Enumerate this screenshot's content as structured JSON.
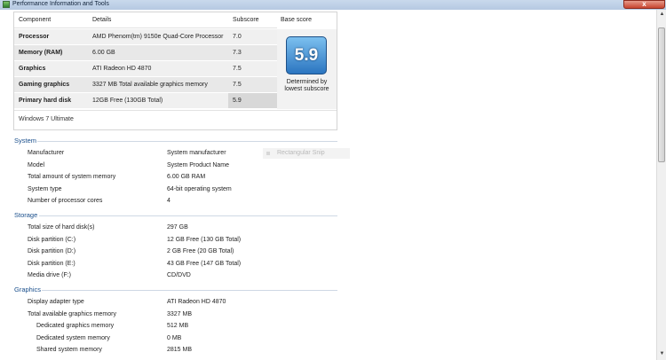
{
  "window": {
    "title": "Performance Information and Tools",
    "close_glyph": "x"
  },
  "score_table": {
    "headers": {
      "component": "Component",
      "details": "Details",
      "subscore": "Subscore",
      "base_score": "Base score"
    },
    "rows": [
      {
        "component": "Processor",
        "details": "AMD Phenom(tm) 9150e Quad-Core Processor",
        "subscore": "7.0"
      },
      {
        "component": "Memory (RAM)",
        "details": "6.00 GB",
        "subscore": "7.3"
      },
      {
        "component": "Graphics",
        "details": "ATI Radeon HD 4870",
        "subscore": "7.5"
      },
      {
        "component": "Gaming graphics",
        "details": "3327 MB Total available graphics memory",
        "subscore": "7.5"
      },
      {
        "component": "Primary hard disk",
        "details": "12GB Free (130GB Total)",
        "subscore": "5.9"
      }
    ],
    "base_score": "5.9",
    "base_caption_line1": "Determined by",
    "base_caption_line2": "lowest subscore",
    "edition": "Windows 7 Ultimate"
  },
  "ghost_tooltip": "Rectangular Snip",
  "sections": {
    "system": {
      "title": "System",
      "items": [
        {
          "label": "Manufacturer",
          "value": "System manufacturer"
        },
        {
          "label": "Model",
          "value": "System Product Name"
        },
        {
          "label": "Total amount of system memory",
          "value": "6.00 GB RAM"
        },
        {
          "label": "System type",
          "value": "64-bit operating system"
        },
        {
          "label": "Number of processor cores",
          "value": "4"
        }
      ]
    },
    "storage": {
      "title": "Storage",
      "items": [
        {
          "label": "Total size of hard disk(s)",
          "value": "297 GB"
        },
        {
          "label": "Disk partition (C:)",
          "value": "12 GB Free (130 GB Total)"
        },
        {
          "label": "Disk partition (D:)",
          "value": "2 GB Free (20 GB Total)"
        },
        {
          "label": "Disk partition (E:)",
          "value": "43 GB Free (147 GB Total)"
        },
        {
          "label": "Media drive (F:)",
          "value": "CD/DVD"
        }
      ]
    },
    "graphics": {
      "title": "Graphics",
      "items": [
        {
          "label": "Display adapter type",
          "value": "ATI Radeon HD 4870"
        },
        {
          "label": "Total available graphics memory",
          "value": "3327 MB"
        },
        {
          "label": "Dedicated graphics memory",
          "value": "512 MB"
        },
        {
          "label": "Dedicated system memory",
          "value": "0 MB"
        },
        {
          "label": "Shared system memory",
          "value": "2815 MB"
        }
      ]
    }
  },
  "scrollbar": {
    "up_glyph": "▲",
    "down_glyph": "▼"
  }
}
